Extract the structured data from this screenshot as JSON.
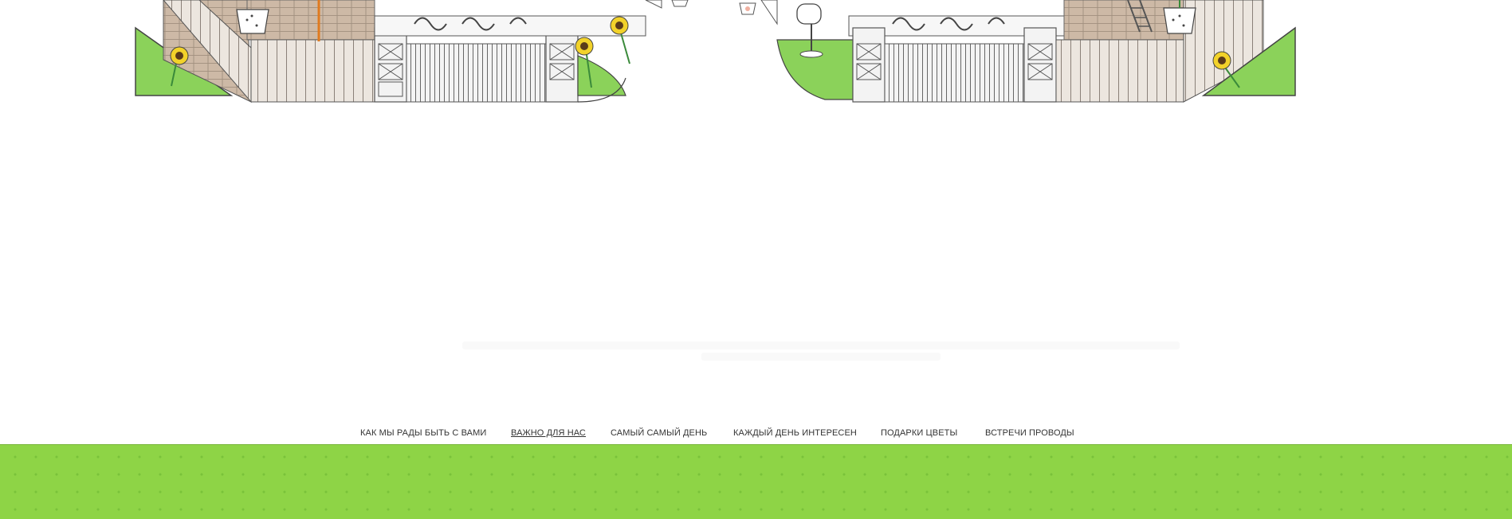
{
  "nav": {
    "items": [
      {
        "label": "КАК МЫ РАДЫ БЫТЬ С ВАМИ",
        "active": false
      },
      {
        "label": "ВАЖНО ДЛЯ НАС",
        "active": true
      },
      {
        "label": "САМЫЙ САМЫЙ ДЕНЬ",
        "active": false
      },
      {
        "label": "КАЖДЫЙ ДЕНЬ ИНТЕРЕСЕН",
        "active": false
      },
      {
        "label": "ПОДАРКИ ЦВЕТЫ",
        "active": false
      },
      {
        "label": "ВСТРЕЧИ ПРОВОДЫ",
        "active": false
      }
    ]
  },
  "colors": {
    "grass": "#8ed446",
    "lawn": "#8bd25a",
    "fence": "#e9e2da",
    "brick": "#cdb9a6",
    "outline": "#555555",
    "sunflower": "#f2d22a",
    "sunflower_center": "#5a3b1a",
    "stem": "#3a8a3a"
  },
  "illustration": {
    "icons": [
      "sunflower-icon",
      "flower-pot-icon",
      "mailbox-icon",
      "ladder-icon",
      "bucket-icon",
      "gate-icon"
    ]
  }
}
